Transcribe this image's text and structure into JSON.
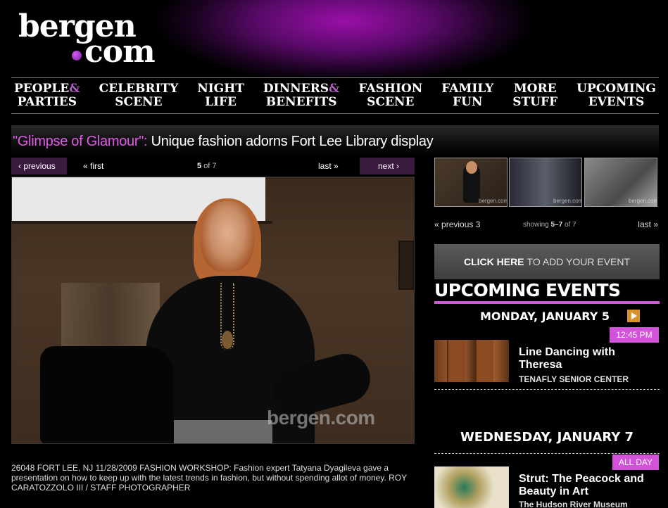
{
  "site": {
    "logo_word": "bergen",
    "logo_tld": "com"
  },
  "nav": [
    {
      "line1": "PEOPLE",
      "amp": "&",
      "line2": "PARTIES"
    },
    {
      "line1": "CELEBRITY",
      "amp": "",
      "line2": "SCENE"
    },
    {
      "line1": "NIGHT",
      "amp": "",
      "line2": "LIFE"
    },
    {
      "line1": "DINNERS",
      "amp": "&",
      "line2": "BENEFITS"
    },
    {
      "line1": "FASHION",
      "amp": "",
      "line2": "SCENE"
    },
    {
      "line1": "FAMILY",
      "amp": "",
      "line2": "FUN"
    },
    {
      "line1": "MORE",
      "amp": "",
      "line2": "STUFF"
    },
    {
      "line1": "UPCOMING",
      "amp": "",
      "line2": "EVENTS"
    }
  ],
  "article": {
    "title_highlight": "\"Glimpse of Glamour\":",
    "title_rest": "Unique fashion adorns Fort Lee Library display",
    "caption": "26048 FORT LEE, NJ 11/28/2009 FASHION WORKSHOP: Fashion expert Tatyana Dyagileva gave a presentation on how to keep up with the latest trends in fashion, but without spending allot of money. ROY CARATOZZOLO III / STAFF PHOTOGRAPHER",
    "watermark": "bergen.com"
  },
  "gallery": {
    "prev_label": "previous",
    "first_label": "first",
    "current": "5",
    "of_label": "of 7",
    "last_label": "last",
    "next_label": "next",
    "thumb_mark": "bergen.com"
  },
  "thumb_nav": {
    "prev_label": "previous 3",
    "showing_label": "showing",
    "range": "5–7",
    "of_label": "of 7",
    "last_label": "last"
  },
  "add_event": {
    "strong": "CLICK HERE",
    "rest": "TO ADD YOUR EVENT"
  },
  "events": {
    "heading": "UPCOMING EVENTS",
    "day1": {
      "date": "MONDAY, JANUARY 5",
      "time": "12:45 PM",
      "title": "Line Dancing with Theresa",
      "venue": "TENAFLY SENIOR CENTER"
    },
    "day2": {
      "date": "WEDNESDAY, JANUARY 7",
      "time": "ALL DAY",
      "title": "Strut: The Peacock and Beauty in Art",
      "venue": "The Hudson River Museum"
    }
  },
  "colors": {
    "accent": "#d252d9",
    "title_highlight": "#e15ce6",
    "orange": "#d7932c"
  }
}
